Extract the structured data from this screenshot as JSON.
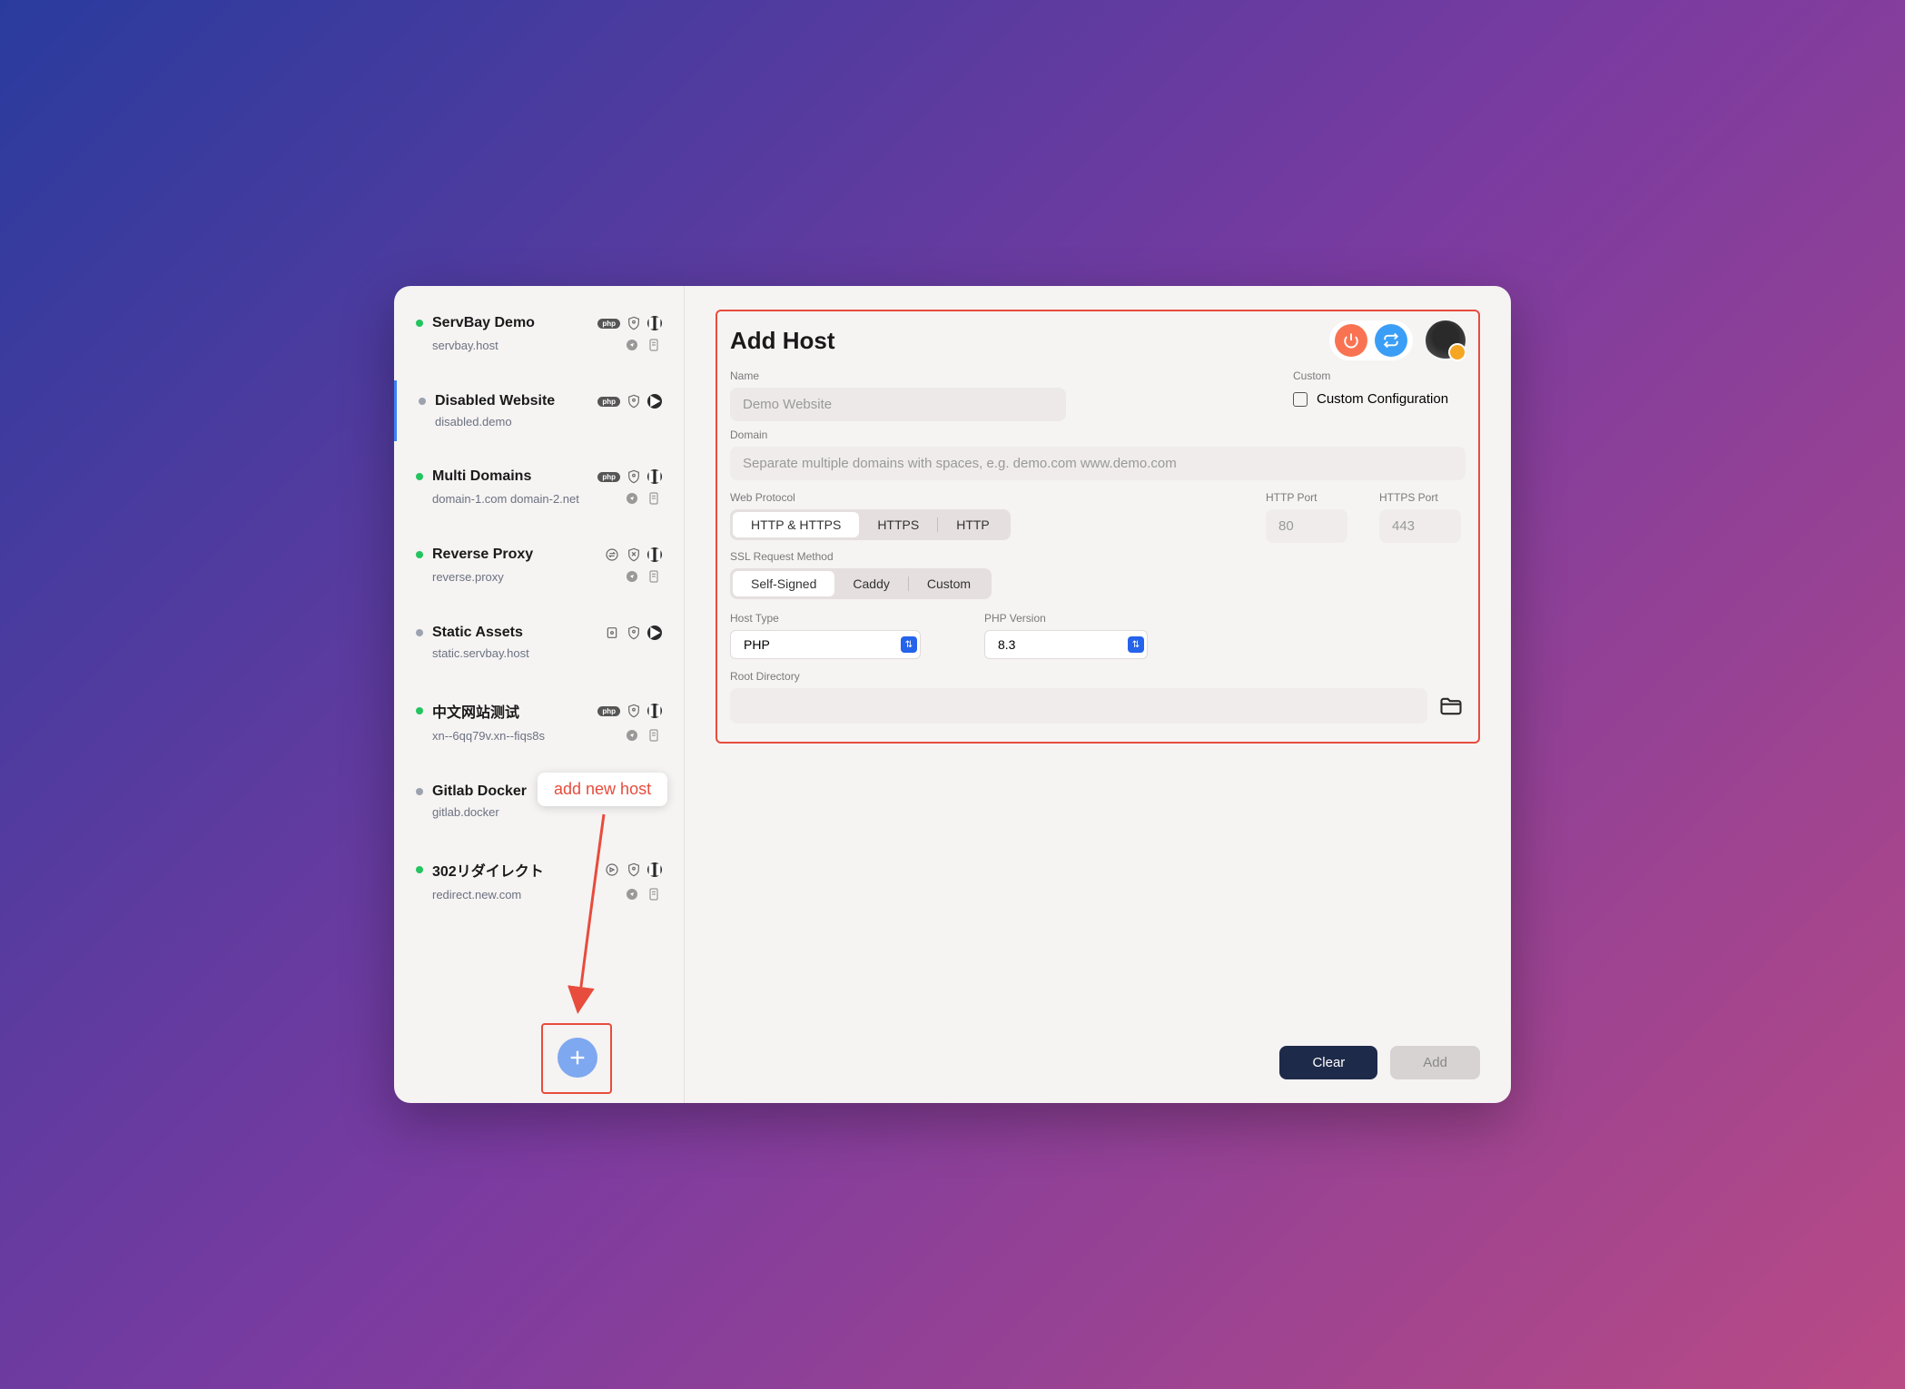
{
  "sidebar": {
    "hosts": [
      {
        "title": "ServBay Demo",
        "sub": "servbay.host",
        "status": "green",
        "icons1": [
          "php",
          "shield",
          "pause"
        ],
        "icons2": [
          "compass",
          "doc"
        ]
      },
      {
        "title": "Disabled Website",
        "sub": "disabled.demo",
        "status": "gray",
        "icons1": [
          "php",
          "shield",
          "play"
        ],
        "icons2": [],
        "selected": true
      },
      {
        "title": "Multi Domains",
        "sub": "domain-1.com domain-2.net",
        "status": "green",
        "icons1": [
          "php",
          "shield",
          "pause"
        ],
        "icons2": [
          "compass",
          "doc"
        ]
      },
      {
        "title": "Reverse Proxy",
        "sub": "reverse.proxy",
        "status": "green",
        "icons1": [
          "swap",
          "shield-x",
          "pause"
        ],
        "icons2": [
          "compass",
          "doc"
        ]
      },
      {
        "title": "Static Assets",
        "sub": "static.servbay.host",
        "status": "gray",
        "icons1": [
          "static",
          "shield",
          "play"
        ],
        "icons2": []
      },
      {
        "title": "中文网站测试",
        "sub": "xn--6qq79v.xn--fiqs8s",
        "status": "green",
        "icons1": [
          "php",
          "shield",
          "pause"
        ],
        "icons2": [
          "compass",
          "doc"
        ]
      },
      {
        "title": "Gitlab Docker",
        "sub": "gitlab.docker",
        "status": "gray",
        "icons1": [
          "swap",
          "shield",
          "play"
        ],
        "icons2": []
      },
      {
        "title": "302リダイレクト",
        "sub": "redirect.new.com",
        "status": "green",
        "icons1": [
          "redirect",
          "shield",
          "pause"
        ],
        "icons2": [
          "compass",
          "doc"
        ]
      }
    ]
  },
  "tooltip": "add new host",
  "main": {
    "title": "Add Host",
    "labels": {
      "name": "Name",
      "domain": "Domain",
      "custom": "Custom",
      "custom_config": "Custom Configuration",
      "web_protocol": "Web Protocol",
      "http_port": "HTTP Port",
      "https_port": "HTTPS Port",
      "ssl": "SSL Request Method",
      "host_type": "Host Type",
      "php_version": "PHP Version",
      "root_dir": "Root Directory"
    },
    "placeholders": {
      "name": "Demo Website",
      "domain": "Separate multiple domains with spaces, e.g. demo.com www.demo.com",
      "http_port": "80",
      "https_port": "443"
    },
    "protocol_options": [
      "HTTP & HTTPS",
      "HTTPS",
      "HTTP"
    ],
    "ssl_options": [
      "Self-Signed",
      "Caddy",
      "Custom"
    ],
    "host_type_value": "PHP",
    "php_version_value": "8.3"
  },
  "footer": {
    "clear": "Clear",
    "add": "Add"
  }
}
